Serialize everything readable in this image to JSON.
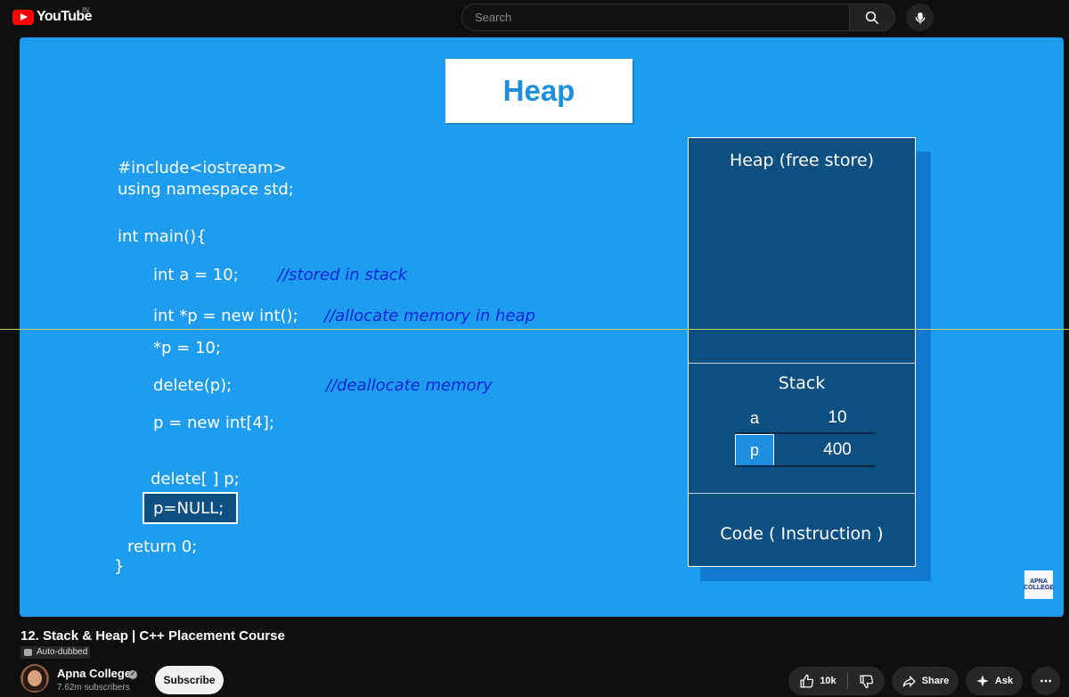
{
  "header": {
    "logo": "YouTube",
    "region": "IN",
    "search_placeholder": "Search"
  },
  "video_slide": {
    "title": "Heap",
    "code_lines": [
      "#include<iostream>",
      "using namespace std;",
      "int main(){",
      "int a = 10;",
      "int *p = new int();",
      "*p = 10;",
      "delete(p);",
      "p = new int[4];",
      "delete[ ] p;",
      "p=NULL;",
      "return 0;",
      "}"
    ],
    "comments": [
      "//stored in stack",
      "//allocate memory in heap",
      "//deallocate memory"
    ],
    "memory": {
      "heap_label": "Heap (free store)",
      "stack_label": "Stack",
      "stack_rows": [
        {
          "name": "a",
          "value": "10"
        },
        {
          "name": "p",
          "value": "400"
        }
      ],
      "code_label": "Code ( Instruction )"
    },
    "watermark": "APNA COLLEGE"
  },
  "video": {
    "title": "12. Stack & Heap | C++ Placement Course",
    "badge": "Auto-dubbed"
  },
  "channel": {
    "name": "Apna College",
    "subscribers": "7.62m subscribers",
    "subscribe_label": "Subscribe"
  },
  "actions": {
    "likes": "10k",
    "share": "Share",
    "ask": "Ask"
  },
  "colors": {
    "slide_bg": "#1e9cf0",
    "memory_panel": "#0e4f82",
    "comment": "#1226d6",
    "brand": "#ff0000"
  }
}
